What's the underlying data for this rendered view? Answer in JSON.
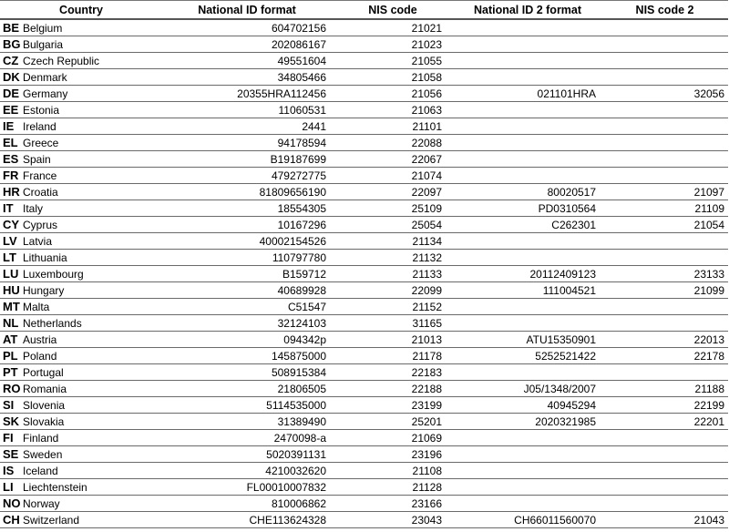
{
  "headers": {
    "country": "Country",
    "national_id_format": "National ID format",
    "nis_code": "NIS code",
    "national_id_2_format": "National ID 2 format",
    "nis_code_2": "NIS code 2"
  },
  "rows": [
    {
      "code": "BE",
      "name": "Belgium",
      "id1": "604702156",
      "nis1": "21021",
      "id2": "",
      "nis2": ""
    },
    {
      "code": "BG",
      "name": "Bulgaria",
      "id1": "202086167",
      "nis1": "21023",
      "id2": "",
      "nis2": ""
    },
    {
      "code": "CZ",
      "name": "Czech Republic",
      "id1": "49551604",
      "nis1": "21055",
      "id2": "",
      "nis2": ""
    },
    {
      "code": "DK",
      "name": "Denmark",
      "id1": "34805466",
      "nis1": "21058",
      "id2": "",
      "nis2": ""
    },
    {
      "code": "DE",
      "name": "Germany",
      "id1": "20355HRA112456",
      "nis1": "21056",
      "id2": "021101HRA",
      "nis2": "32056"
    },
    {
      "code": "EE",
      "name": "Estonia",
      "id1": "11060531",
      "nis1": "21063",
      "id2": "",
      "nis2": ""
    },
    {
      "code": "IE",
      "name": "Ireland",
      "id1": "2441",
      "nis1": "21101",
      "id2": "",
      "nis2": ""
    },
    {
      "code": "EL",
      "name": "Greece",
      "id1": "94178594",
      "nis1": "22088",
      "id2": "",
      "nis2": ""
    },
    {
      "code": "ES",
      "name": "Spain",
      "id1": "B19187699",
      "nis1": "22067",
      "id2": "",
      "nis2": ""
    },
    {
      "code": "FR",
      "name": "France",
      "id1": "479272775",
      "nis1": "21074",
      "id2": "",
      "nis2": ""
    },
    {
      "code": "HR",
      "name": "Croatia",
      "id1": "81809656190",
      "nis1": "22097",
      "id2": "80020517",
      "nis2": "21097"
    },
    {
      "code": "IT",
      "name": "Italy",
      "id1": "18554305",
      "nis1": "25109",
      "id2": "PD0310564",
      "nis2": "21109"
    },
    {
      "code": "CY",
      "name": "Cyprus",
      "id1": "10167296",
      "nis1": "25054",
      "id2": "C262301",
      "nis2": "21054"
    },
    {
      "code": "LV",
      "name": "Latvia",
      "id1": "40002154526",
      "nis1": "21134",
      "id2": "",
      "nis2": ""
    },
    {
      "code": "LT",
      "name": "Lithuania",
      "id1": "110797780",
      "nis1": "21132",
      "id2": "",
      "nis2": ""
    },
    {
      "code": "LU",
      "name": "Luxembourg",
      "id1": "B159712",
      "nis1": "21133",
      "id2": "20112409123",
      "nis2": "23133"
    },
    {
      "code": "HU",
      "name": "Hungary",
      "id1": "40689928",
      "nis1": "22099",
      "id2": "111004521",
      "nis2": "21099"
    },
    {
      "code": "MT",
      "name": "Malta",
      "id1": "C51547",
      "nis1": "21152",
      "id2": "",
      "nis2": ""
    },
    {
      "code": "NL",
      "name": "Netherlands",
      "id1": "32124103",
      "nis1": "31165",
      "id2": "",
      "nis2": ""
    },
    {
      "code": "AT",
      "name": "Austria",
      "id1": "094342p",
      "nis1": "21013",
      "id2": "ATU15350901",
      "nis2": "22013"
    },
    {
      "code": "PL",
      "name": "Poland",
      "id1": "145875000",
      "nis1": "21178",
      "id2": "5252521422",
      "nis2": "22178"
    },
    {
      "code": "PT",
      "name": "Portugal",
      "id1": "508915384",
      "nis1": "22183",
      "id2": "",
      "nis2": ""
    },
    {
      "code": "RO",
      "name": "Romania",
      "id1": "21806505",
      "nis1": "22188",
      "id2": "J05/1348/2007",
      "nis2": "21188"
    },
    {
      "code": "SI",
      "name": "Slovenia",
      "id1": "5114535000",
      "nis1": "23199",
      "id2": "40945294",
      "nis2": "22199"
    },
    {
      "code": "SK",
      "name": "Slovakia",
      "id1": "31389490",
      "nis1": "25201",
      "id2": "2020321985",
      "nis2": "22201"
    },
    {
      "code": "FI",
      "name": "Finland",
      "id1": "2470098-a",
      "nis1": "21069",
      "id2": "",
      "nis2": ""
    },
    {
      "code": "SE",
      "name": "Sweden",
      "id1": "5020391131",
      "nis1": "23196",
      "id2": "",
      "nis2": ""
    },
    {
      "code": "IS",
      "name": "Iceland",
      "id1": "4210032620",
      "nis1": "21108",
      "id2": "",
      "nis2": ""
    },
    {
      "code": "LI",
      "name": "Liechtenstein",
      "id1": "FL00010007832",
      "nis1": "21128",
      "id2": "",
      "nis2": ""
    },
    {
      "code": "NO",
      "name": "Norway",
      "id1": "810006862",
      "nis1": "23166",
      "id2": "",
      "nis2": ""
    },
    {
      "code": "CH",
      "name": "Switzerland",
      "id1": "CHE113624328",
      "nis1": "23043",
      "id2": "CH66011560070",
      "nis2": "21043"
    }
  ]
}
